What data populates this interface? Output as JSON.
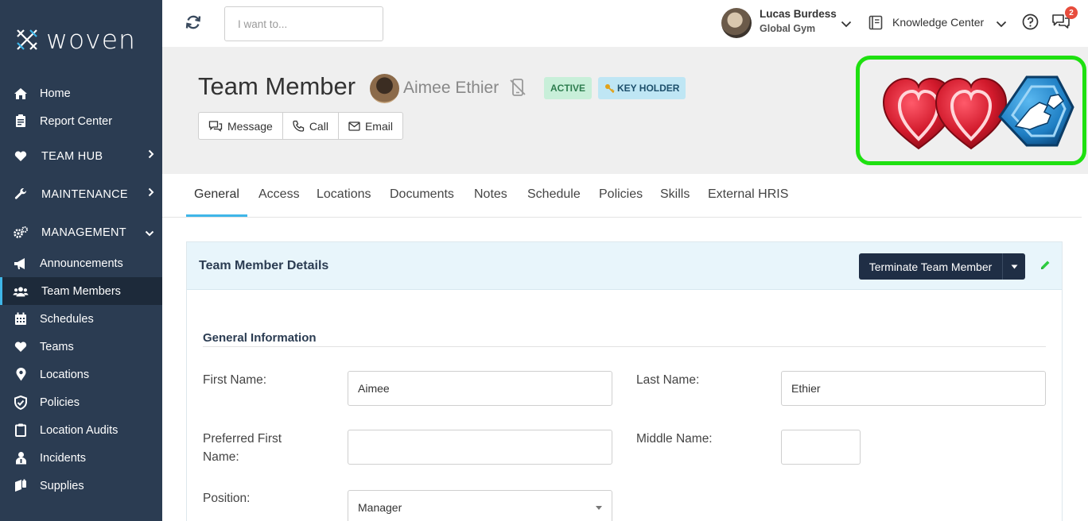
{
  "brand": {
    "name": "woven"
  },
  "sidebar": {
    "items": [
      {
        "label": "Home",
        "icon": "home-icon"
      },
      {
        "label": "Report Center",
        "icon": "report-icon"
      },
      {
        "label": "TEAM HUB",
        "icon": "heart-icon",
        "section": true,
        "chevron": "right"
      },
      {
        "label": "MAINTENANCE",
        "icon": "wrench-icon",
        "section": true,
        "chevron": "right"
      },
      {
        "label": "MANAGEMENT",
        "icon": "gears-icon",
        "section": true,
        "chevron": "down"
      },
      {
        "label": "Announcements",
        "icon": "megaphone-icon"
      },
      {
        "label": "Team Members",
        "icon": "users-icon",
        "active": true
      },
      {
        "label": "Schedules",
        "icon": "calendar-icon"
      },
      {
        "label": "Teams",
        "icon": "heart-icon"
      },
      {
        "label": "Locations",
        "icon": "map-pin-icon"
      },
      {
        "label": "Policies",
        "icon": "shield-icon"
      },
      {
        "label": "Location Audits",
        "icon": "clipboard-icon"
      },
      {
        "label": "Incidents",
        "icon": "person-icon"
      },
      {
        "label": "Supplies",
        "icon": "supplies-icon"
      }
    ]
  },
  "topbar": {
    "search_placeholder": "I want to...",
    "user": {
      "name": "Lucas Burdess",
      "org": "Global Gym"
    },
    "knowledge_center": "Knowledge Center",
    "messages_badge": "2"
  },
  "header": {
    "title": "Team Member",
    "member_name": "Aimee Ethier",
    "badges": {
      "active": "ACTIVE",
      "key_holder": "KEY HOLDER"
    },
    "actions": {
      "message": "Message",
      "call": "Call",
      "email": "Email"
    }
  },
  "tabs": [
    "General",
    "Access",
    "Locations",
    "Documents",
    "Notes",
    "Schedule",
    "Policies",
    "Skills",
    "External HRIS"
  ],
  "panel": {
    "title": "Team Member Details",
    "terminate_label": "Terminate Team Member",
    "section_title": "General Information",
    "fields": {
      "first_name": {
        "label": "First Name:",
        "value": "Aimee"
      },
      "last_name": {
        "label": "Last Name:",
        "value": "Ethier"
      },
      "preferred_first_name": {
        "label": "Preferred First Name:",
        "value": ""
      },
      "middle_name": {
        "label": "Middle Name:",
        "value": ""
      },
      "position": {
        "label": "Position:",
        "value": "Manager"
      }
    }
  },
  "colors": {
    "sidebar_bg": "#2b3c52",
    "accent": "#3fb6e8",
    "highlight_border": "#1ee010",
    "terminate_bg": "#1f2e45"
  }
}
